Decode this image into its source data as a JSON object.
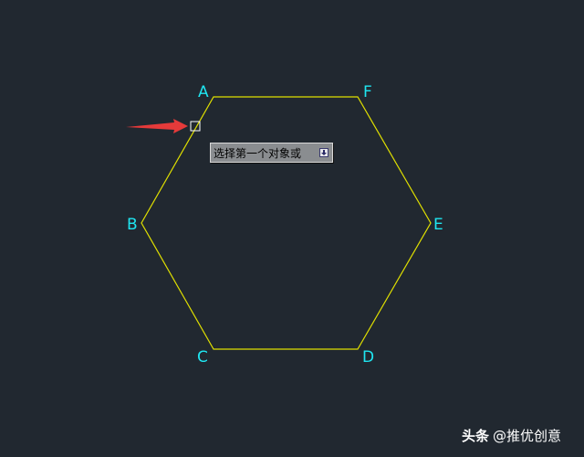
{
  "drawing": {
    "colors": {
      "background": "#212830",
      "hexagon_stroke": "#e0e000",
      "vertex_label": "#1fe5f0",
      "arrow": "#e53a3a",
      "pick_box": "#ffffff"
    },
    "vertices": [
      {
        "label": "A"
      },
      {
        "label": "B"
      },
      {
        "label": "C"
      },
      {
        "label": "D"
      },
      {
        "label": "E"
      },
      {
        "label": "F"
      }
    ]
  },
  "tooltip": {
    "text": "选择第一个对象或",
    "button_icon": "dropdown-arrow-icon"
  },
  "watermark": {
    "brand": "头条",
    "handle": "@推优创意"
  }
}
